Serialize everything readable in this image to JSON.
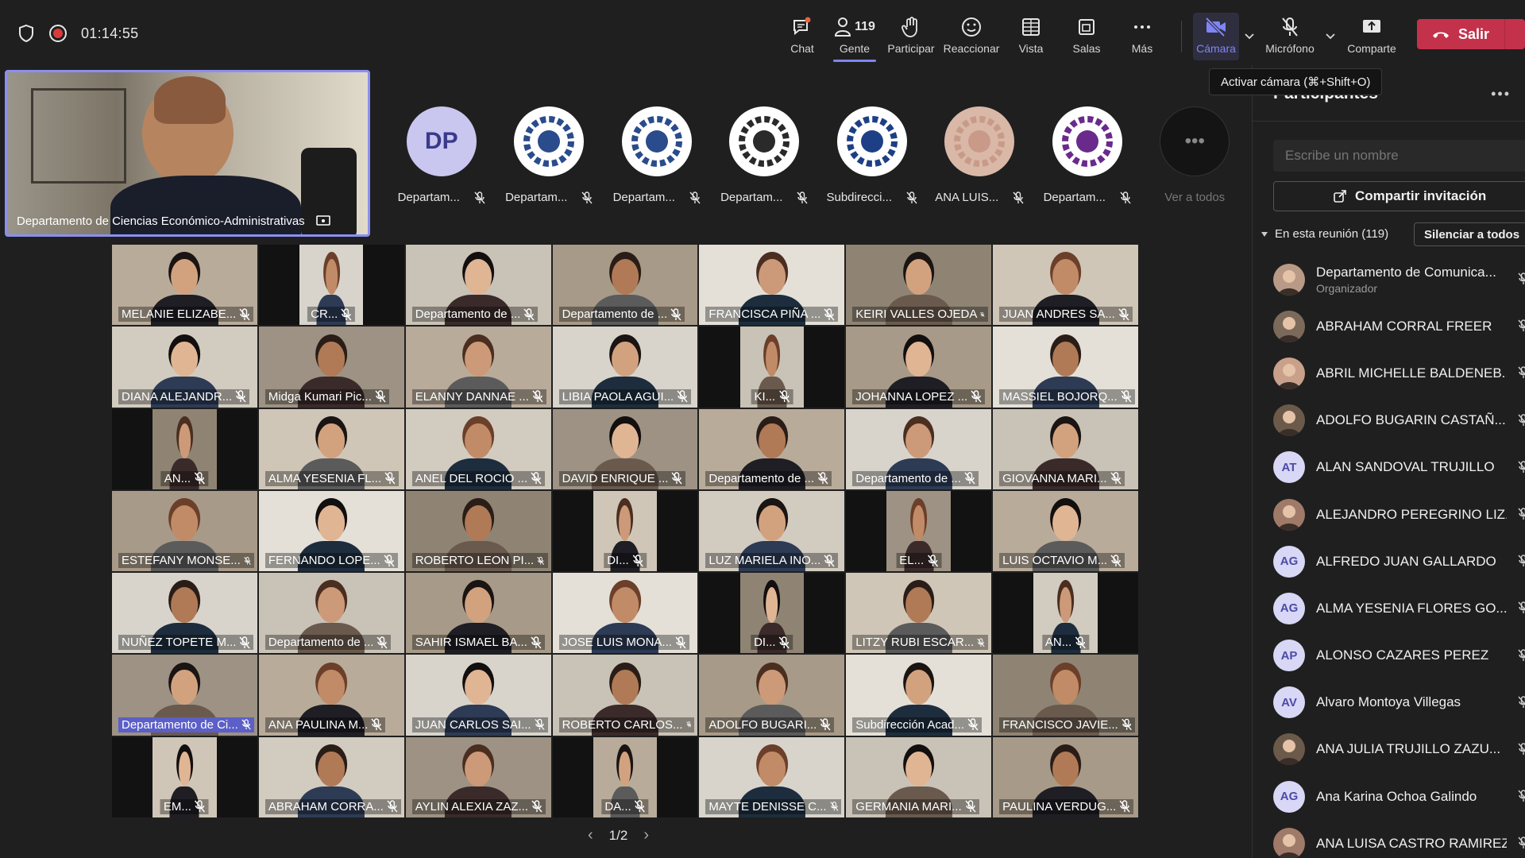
{
  "meeting": {
    "timer": "01:14:55"
  },
  "toolbar": {
    "chat": "Chat",
    "people_count": "119",
    "people": "Gente",
    "participate": "Participar",
    "react": "Reaccionar",
    "view": "Vista",
    "rooms": "Salas",
    "more": "Más",
    "camera": "Cámara",
    "mic": "Micrófono",
    "share": "Comparte",
    "leave": "Salir"
  },
  "tooltip": "Activar cámara (⌘+Shift+O)",
  "self_tile": {
    "name": "Departamento de Ciencias Económico-Administrativas"
  },
  "featured": [
    {
      "initials": "DP",
      "label": "Departam..."
    },
    {
      "label": "Departam..."
    },
    {
      "label": "Departam..."
    },
    {
      "label": "Departam..."
    },
    {
      "label": "Subdirecci..."
    },
    {
      "label": "ANA LUIS..."
    },
    {
      "label": "Departam..."
    },
    {
      "label": "Ver a todos"
    }
  ],
  "grid": [
    "MELANIE ELIZABE...",
    "CR...",
    "Departamento de ...",
    "Departamento de ...",
    "FRANCISCA PIÑA ...",
    "KEIRI VALLES OJEDA",
    "JUAN ANDRES SA...",
    "DIANA ALEJANDR...",
    "Midga Kumari Pic...",
    "ELANNY DANNAE ...",
    "LIBIA PAOLA AGUI...",
    "KI...",
    "JOHANNA LOPEZ ...",
    "MASSIEL BOJORQ...",
    "AN...",
    "ALMA YESENIA FL...",
    "ANEL DEL ROCIO ...",
    "DAVID ENRIQUE ...",
    "Departamento de ...",
    "Departamento de ...",
    "GIOVANNA MARI...",
    "ESTEFANY MONSE...",
    "FERNANDO LOPE...",
    "ROBERTO LEON PI...",
    "DI...",
    "LUZ MARIELA INO...",
    "EL...",
    "LUIS OCTAVIO M...",
    "NUÑEZ TOPETE M...",
    "Departamento de ...",
    "SAHIR ISMAEL BA...",
    "JOSE LUIS MONA...",
    "DI...",
    "LITZY RUBI ESCAR...",
    "AN...",
    "Departamento de Ci...",
    "ANA PAULINA M...",
    "JUAN CARLOS SAI...",
    "ROBERTO CARLOS...",
    "ADOLFO BUGARI...",
    "Subdirección Acad...",
    "FRANCISCO JAVIE...",
    "EM...",
    "ABRAHAM CORRA...",
    "AYLIN ALEXIA ZAZ...",
    "DA...",
    "MAYTE DENISSE C...",
    "GERMANIA MARI...",
    "PAULINA VERDUG..."
  ],
  "pager": "1/2",
  "panel": {
    "title": "Participantes",
    "search_placeholder": "Escribe un nombre",
    "invite": "Compartir invitación",
    "in_meeting": "En esta reunión (119)",
    "mute_all": "Silenciar a todos",
    "participants": [
      {
        "name": "Departamento de Comunica...",
        "role": "Organizador"
      },
      {
        "name": "ABRAHAM CORRAL FREER"
      },
      {
        "name": "ABRIL MICHELLE BALDENEB..."
      },
      {
        "name": "ADOLFO BUGARIN CASTAÑ..."
      },
      {
        "name": "ALAN SANDOVAL TRUJILLO",
        "initials": "AT"
      },
      {
        "name": "ALEJANDRO PEREGRINO LIZ..."
      },
      {
        "name": "ALFREDO JUAN GALLARDO",
        "initials": "AG"
      },
      {
        "name": "ALMA YESENIA FLORES GO...",
        "initials": "AG"
      },
      {
        "name": "ALONSO CAZARES PEREZ",
        "initials": "AP"
      },
      {
        "name": "Alvaro Montoya Villegas",
        "initials": "AV"
      },
      {
        "name": "ANA JULIA TRUJILLO ZAZU..."
      },
      {
        "name": "Ana Karina Ochoa Galindo",
        "initials": "AG"
      },
      {
        "name": "ANA LUISA CASTRO RAMIREZ"
      }
    ]
  },
  "colors": {
    "accent": "#7f85f5",
    "leave": "#c4314b",
    "background": "#1f1f1f"
  }
}
